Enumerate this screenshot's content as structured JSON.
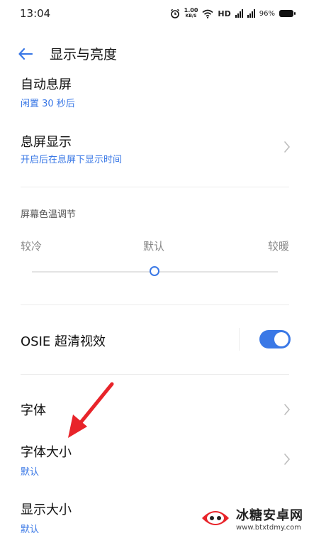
{
  "status": {
    "time": "13:04",
    "net_speed_top": "1.00",
    "net_speed_bottom": "KB/S",
    "hd": "HD",
    "battery": "96%"
  },
  "header": {
    "title": "显示与亮度"
  },
  "items": {
    "auto_screen_off": {
      "title": "自动息屏",
      "subtitle": "闲置 30 秒后"
    },
    "aod": {
      "title": "息屏显示",
      "subtitle": "开启后在息屏下显示时间"
    },
    "color_temp": {
      "label": "屏幕色温调节",
      "cold": "较冷",
      "default": "默认",
      "warm": "较暖",
      "level": 0.5
    },
    "osie": {
      "title": "OSIE 超清视效",
      "enabled": true
    },
    "font": {
      "title": "字体"
    },
    "font_size": {
      "title": "字体大小",
      "subtitle": "默认"
    },
    "display_size": {
      "title": "显示大小",
      "subtitle": "默认"
    }
  },
  "watermark": {
    "title": "冰糖安卓网",
    "url": "www.btxtdmy.com"
  },
  "colors": {
    "accent": "#3a78e6",
    "arrow": "#e8242a"
  }
}
